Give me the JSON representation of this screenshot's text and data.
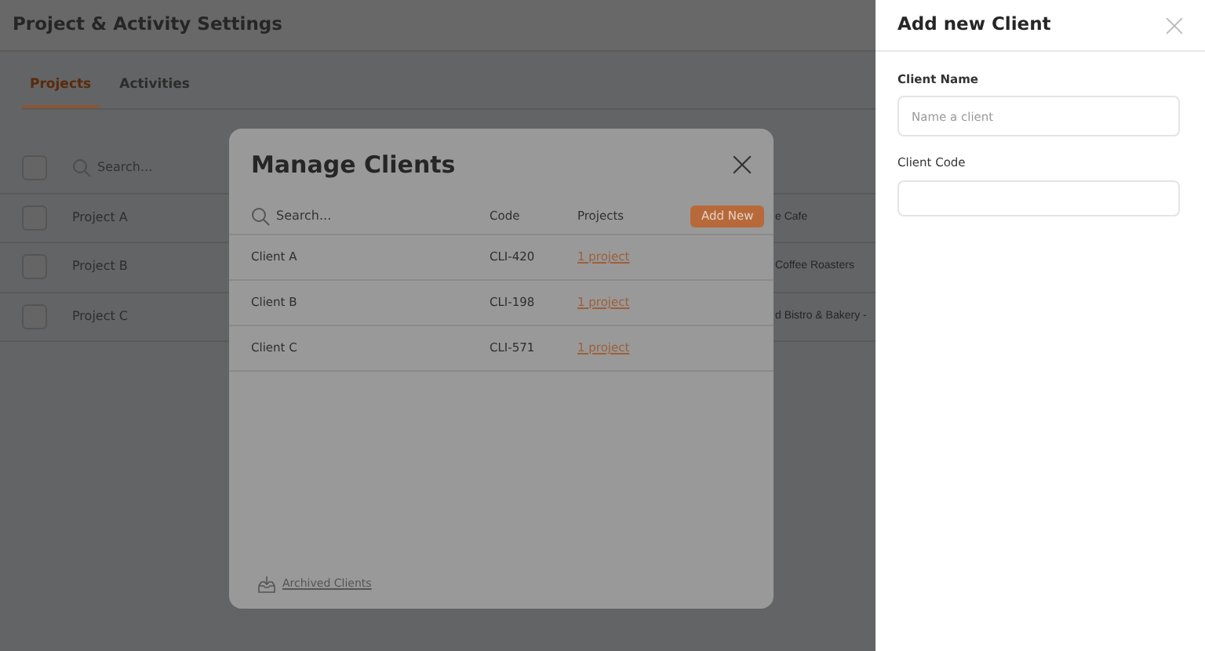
{
  "page": {
    "title": "Project & Activity Settings",
    "tabs": [
      {
        "label": "Projects",
        "selected": true
      },
      {
        "label": "Activities",
        "selected": false
      }
    ],
    "table": {
      "search_placeholder": "Search...",
      "all_checked": false,
      "rows": [
        {
          "name": "Project A",
          "client": "e Cafe",
          "checked": false
        },
        {
          "name": "Project B",
          "client": "Coffee Roasters",
          "checked": false
        },
        {
          "name": "Project C",
          "client": "d Bistro & Bakery -",
          "checked": false
        }
      ]
    }
  },
  "modal": {
    "title": "Manage Clients",
    "search_placeholder": "Search...",
    "columns": [
      "Code",
      "Projects"
    ],
    "add_button": "Add New",
    "rows": [
      {
        "name": "Client A",
        "code": "CLI-420",
        "projects": "1 project"
      },
      {
        "name": "Client B",
        "code": "CLI-198",
        "projects": "1 project"
      },
      {
        "name": "Client C",
        "code": "CLI-571",
        "projects": "1 project"
      }
    ],
    "footer_link": "Archived Clients"
  },
  "drawer": {
    "title": "Add new Client",
    "fields": [
      {
        "label": "Client Name",
        "placeholder": "Name a client",
        "required": true
      },
      {
        "label": "Client Code",
        "required": false
      }
    ]
  }
}
